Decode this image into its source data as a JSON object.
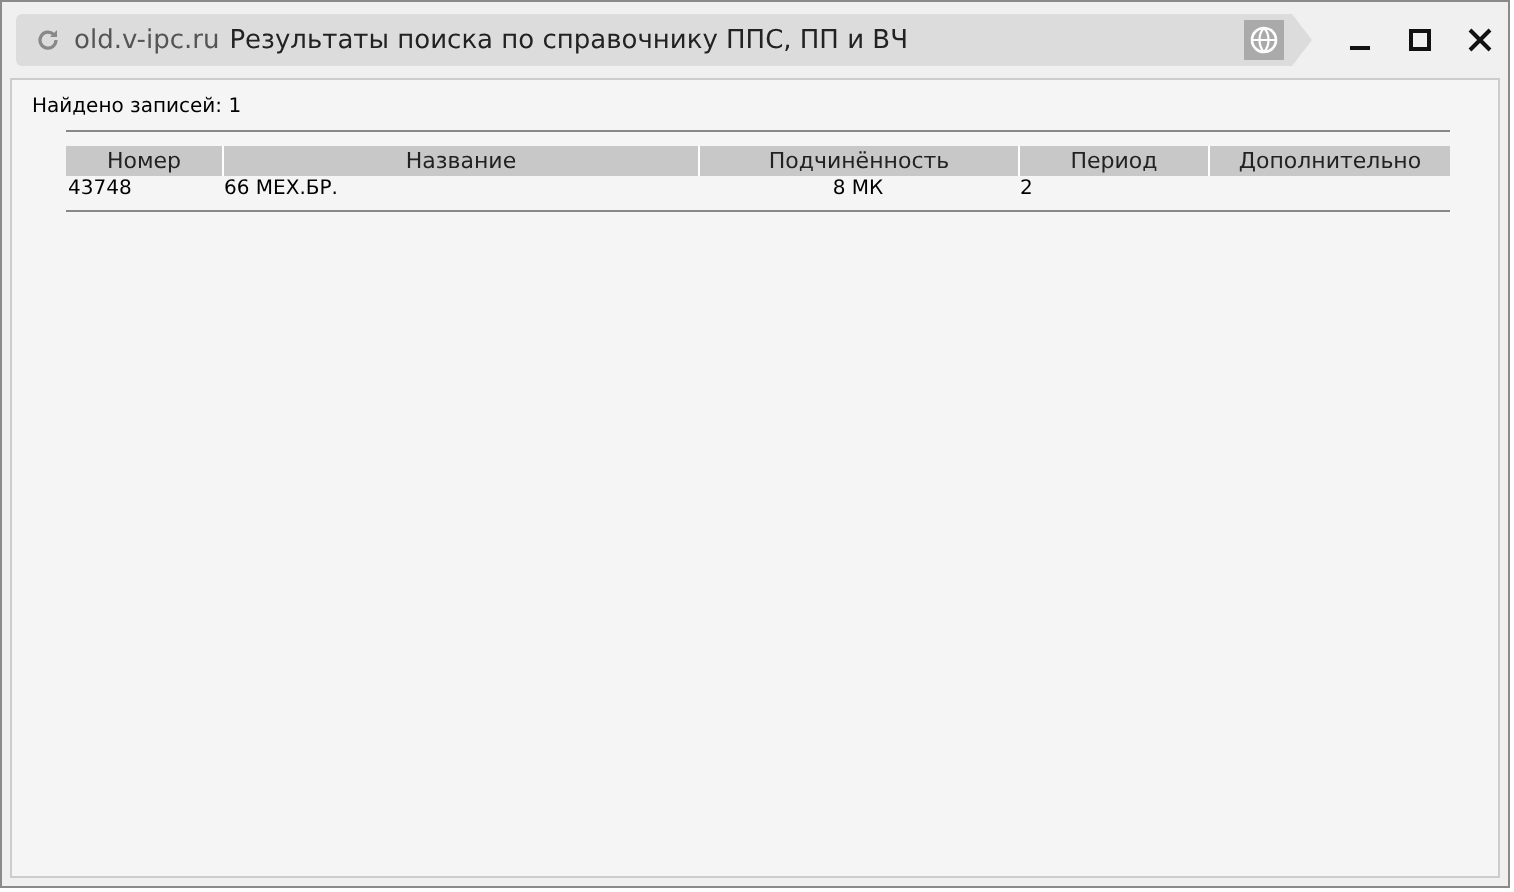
{
  "window": {
    "domain": "old.v-ipc.ru",
    "title": "Результаты поиска по справочнику ППС, ПП и ВЧ"
  },
  "found": "Найдено записей: 1",
  "table": {
    "columns": [
      "Номер",
      "Название",
      "Подчинённость",
      "Период",
      "Дополнительно"
    ],
    "rows": [
      {
        "cells": [
          "43748",
          "66 МЕХ.БР.",
          "8 МК",
          "2",
          ""
        ]
      }
    ]
  }
}
